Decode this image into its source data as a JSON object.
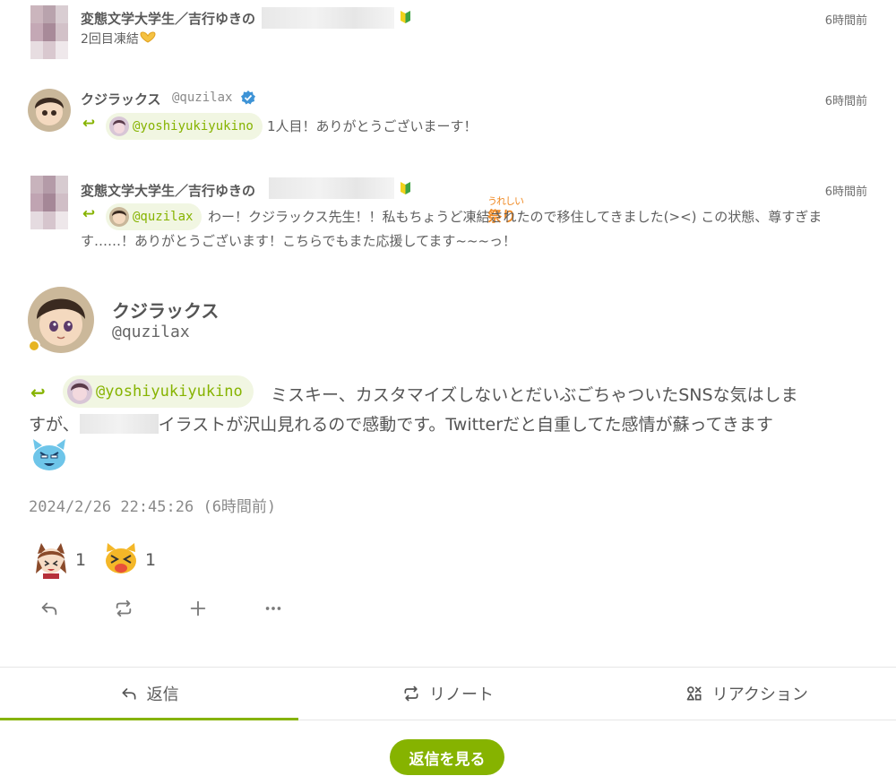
{
  "notes": [
    {
      "name": "変態文学大学生／吉行ゆきの",
      "time": "6時間前",
      "text": "2回目凍結",
      "emoji": "heart-hands-emoji"
    },
    {
      "name": "クジラックス",
      "handle": "@quzilax",
      "time": "6時間前",
      "mention": "@yoshiyukiyukino",
      "text": "1人目！ありがとうございまーす！",
      "sticker_top": "うれしい",
      "sticker_bottom": "祭り"
    },
    {
      "name": "変態文学大学生／吉行ゆきの",
      "time": "6時間前",
      "mention": "@quzilax",
      "text_line1": "わー！クジラックス先生！！私もちょうど凍結されたので移住してきました(><) この状態、尊すぎま",
      "text_line2": "す……！ありがとうございます！こちらでもまた応援してます~~~っ！"
    }
  ],
  "main": {
    "name": "クジラックス",
    "handle": "@quzilax",
    "mention": "@yoshiyukiyukino",
    "text_line1": "ミスキー、カスタマイズしないとだいぶごちゃついたSNSな気はしま",
    "text_line2_a": "すが、",
    "text_line2_b": "イラストが沢山見れるので感動です。Twitterだと自重してた感情が蘇ってきます",
    "timestamp": "2024/2/26 22:45:26 (6時間前)",
    "reactions": [
      {
        "icon": "fox-girl-emoji",
        "count": "1"
      },
      {
        "icon": "crying-cat-emoji",
        "count": "1"
      }
    ]
  },
  "actions": [
    "reply-icon",
    "renote-icon",
    "plus-icon",
    "more-icon"
  ],
  "tabs": [
    {
      "label": "返信",
      "icon": "reply-icon"
    },
    {
      "label": "リノート",
      "icon": "renote-icon"
    },
    {
      "label": "リアクション",
      "icon": "reaction-icon"
    }
  ],
  "see_replies": "返信を見る",
  "colors": {
    "accent": "#86b300",
    "mention_bg": "#f1f6e2",
    "status": "#e6b422"
  }
}
